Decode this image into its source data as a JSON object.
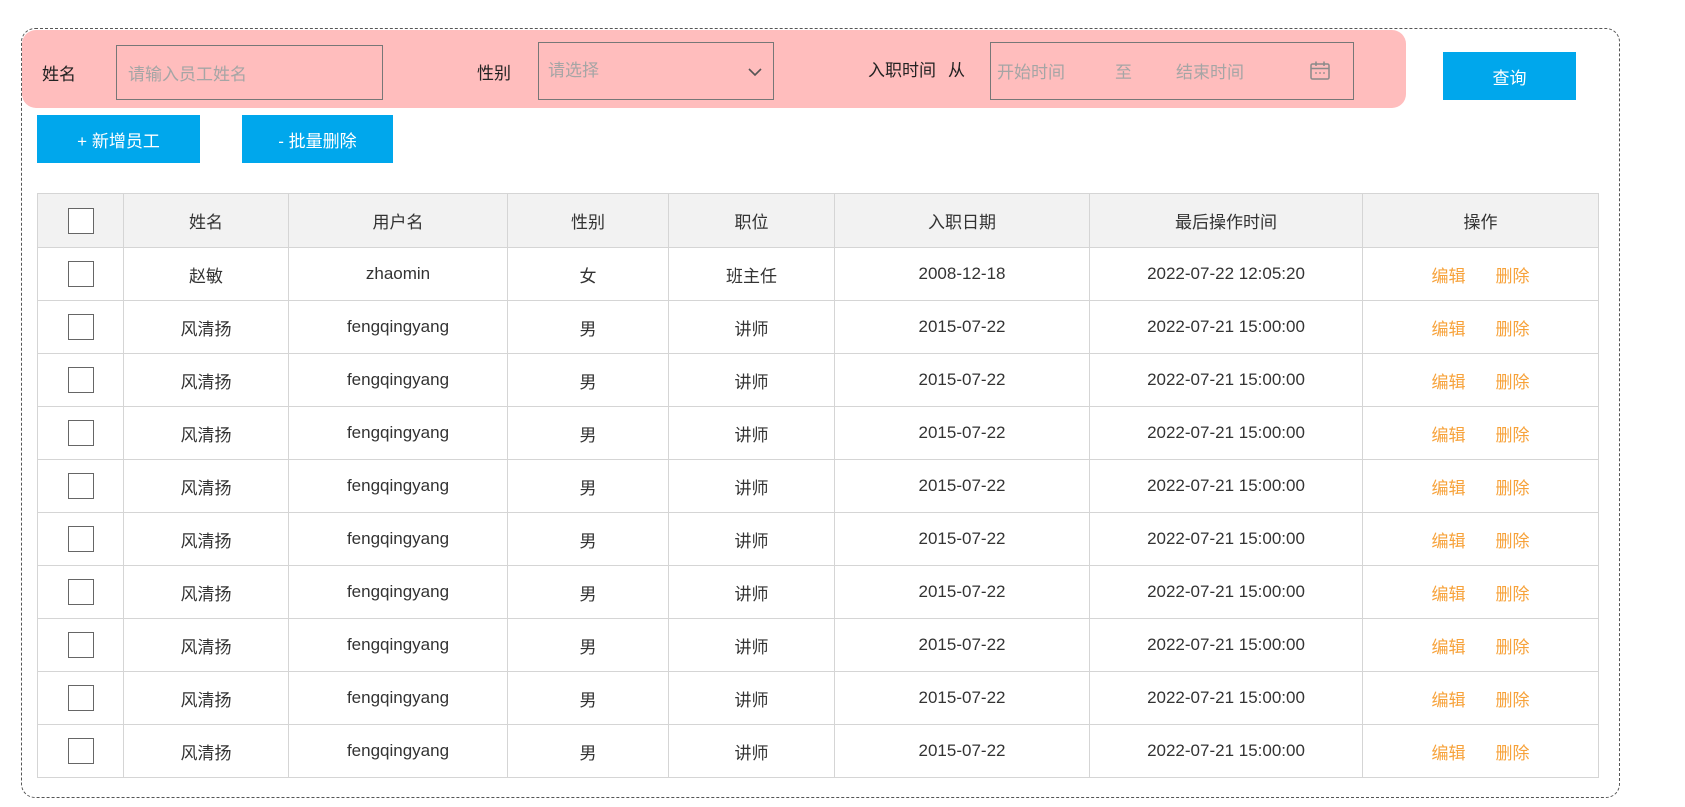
{
  "search": {
    "name_label": "姓名",
    "name_placeholder": "请输入员工姓名",
    "gender_label": "性别",
    "gender_selected": "请选择",
    "hire_label": "入职时间",
    "hire_from": "从",
    "start_placeholder": "开始时间",
    "range_sep": "至",
    "end_placeholder": "结束时间",
    "query_button": "查询"
  },
  "toolbar": {
    "add_button": "+ 新增员工",
    "batch_delete_button": "- 批量删除"
  },
  "table": {
    "headers": [
      "姓名",
      "用户名",
      "性别",
      "职位",
      "入职日期",
      "最后操作时间",
      "操作"
    ],
    "rows": [
      {
        "name": "赵敏",
        "username": "zhaomin",
        "gender": "女",
        "position": "班主任",
        "hire_date": "2008-12-18",
        "last_op": "2022-07-22 12:05:20",
        "edit": "编辑",
        "delete": "删除"
      },
      {
        "name": "风清扬",
        "username": "fengqingyang",
        "gender": "男",
        "position": "讲师",
        "hire_date": "2015-07-22",
        "last_op": "2022-07-21 15:00:00",
        "edit": "编辑",
        "delete": "删除"
      },
      {
        "name": "风清扬",
        "username": "fengqingyang",
        "gender": "男",
        "position": "讲师",
        "hire_date": "2015-07-22",
        "last_op": "2022-07-21 15:00:00",
        "edit": "编辑",
        "delete": "删除"
      },
      {
        "name": "风清扬",
        "username": "fengqingyang",
        "gender": "男",
        "position": "讲师",
        "hire_date": "2015-07-22",
        "last_op": "2022-07-21 15:00:00",
        "edit": "编辑",
        "delete": "删除"
      },
      {
        "name": "风清扬",
        "username": "fengqingyang",
        "gender": "男",
        "position": "讲师",
        "hire_date": "2015-07-22",
        "last_op": "2022-07-21 15:00:00",
        "edit": "编辑",
        "delete": "删除"
      },
      {
        "name": "风清扬",
        "username": "fengqingyang",
        "gender": "男",
        "position": "讲师",
        "hire_date": "2015-07-22",
        "last_op": "2022-07-21 15:00:00",
        "edit": "编辑",
        "delete": "删除"
      },
      {
        "name": "风清扬",
        "username": "fengqingyang",
        "gender": "男",
        "position": "讲师",
        "hire_date": "2015-07-22",
        "last_op": "2022-07-21 15:00:00",
        "edit": "编辑",
        "delete": "删除"
      },
      {
        "name": "风清扬",
        "username": "fengqingyang",
        "gender": "男",
        "position": "讲师",
        "hire_date": "2015-07-22",
        "last_op": "2022-07-21 15:00:00",
        "edit": "编辑",
        "delete": "删除"
      },
      {
        "name": "风清扬",
        "username": "fengqingyang",
        "gender": "男",
        "position": "讲师",
        "hire_date": "2015-07-22",
        "last_op": "2022-07-21 15:00:00",
        "edit": "编辑",
        "delete": "删除"
      },
      {
        "name": "风清扬",
        "username": "fengqingyang",
        "gender": "男",
        "position": "讲师",
        "hire_date": "2015-07-22",
        "last_op": "2022-07-21 15:00:00",
        "edit": "编辑",
        "delete": "删除"
      }
    ]
  },
  "icons": {
    "calendar": "calendar-icon",
    "dropdown": "chevron-down-icon"
  },
  "colors": {
    "accent": "#00a7ec",
    "action": "#f7a23a",
    "highlight": "#ffbdbd"
  }
}
